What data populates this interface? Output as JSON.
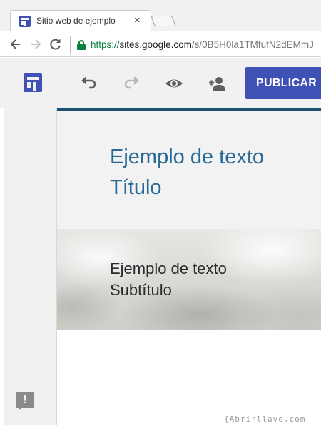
{
  "browser": {
    "tab_title": "Sitio web de ejemplo",
    "tab_close": "×",
    "url_scheme": "https://",
    "url_host": "sites.google.com",
    "url_path": "/s/0B5H0la1TMfufN2dEMmJ"
  },
  "toolbar": {
    "publish_label": "PUBLICAR",
    "redo_enabled": false
  },
  "page": {
    "title_line1": "Ejemplo de texto",
    "title_line2": "Título",
    "subtitle_line1": "Ejemplo de texto",
    "subtitle_line2": "Subtítulo"
  },
  "feedback_glyph": "!",
  "watermark": "{Abrirllave.com",
  "colors": {
    "accent": "#3f51b5",
    "title_text": "#2a6a97",
    "secure_green": "#0b8043",
    "toolbar_line": "#1b4f72"
  }
}
